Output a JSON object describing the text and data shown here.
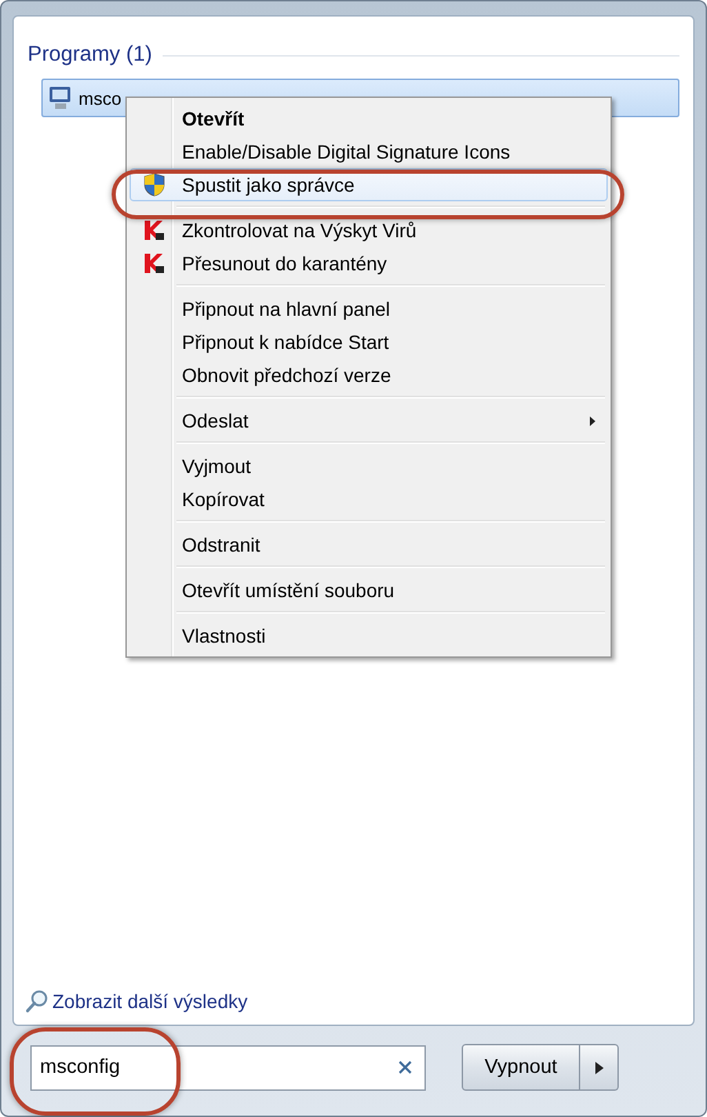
{
  "section": {
    "title": "Programy (1)"
  },
  "results": [
    {
      "label": "msco",
      "selected": true
    }
  ],
  "context_menu": {
    "items": [
      {
        "kind": "item",
        "label": "Otevřít",
        "default": true,
        "selected": false
      },
      {
        "kind": "item",
        "label": "Enable/Disable Digital Signature Icons",
        "default": false,
        "selected": false
      },
      {
        "kind": "admin",
        "label": "Spustit jako správce",
        "default": false,
        "selected": true,
        "circled": true
      },
      {
        "kind": "separator"
      },
      {
        "kind": "scan",
        "label": "Zkontrolovat na Výskyt Virů",
        "default": false,
        "selected": false
      },
      {
        "kind": "scan",
        "label": "Přesunout do karantény",
        "default": false,
        "selected": false
      },
      {
        "kind": "separator"
      },
      {
        "kind": "item",
        "label": "Připnout na hlavní panel",
        "default": false,
        "selected": false
      },
      {
        "kind": "item",
        "label": "Připnout k nabídce Start",
        "default": false,
        "selected": false
      },
      {
        "kind": "item",
        "label": "Obnovit předchozí verze",
        "default": false,
        "selected": false
      },
      {
        "kind": "separator"
      },
      {
        "kind": "item",
        "label": "Odeslat",
        "default": false,
        "selected": false,
        "submenu": true
      },
      {
        "kind": "separator"
      },
      {
        "kind": "item",
        "label": "Vyjmout",
        "default": false,
        "selected": false
      },
      {
        "kind": "item",
        "label": "Kopírovat",
        "default": false,
        "selected": false
      },
      {
        "kind": "separator"
      },
      {
        "kind": "item",
        "label": "Odstranit",
        "default": false,
        "selected": false
      },
      {
        "kind": "separator"
      },
      {
        "kind": "item",
        "label": "Otevřít umístění souboru",
        "default": false,
        "selected": false
      },
      {
        "kind": "separator"
      },
      {
        "kind": "item",
        "label": "Vlastnosti",
        "default": false,
        "selected": false
      }
    ]
  },
  "more_results": {
    "label": "Zobrazit další výsledky"
  },
  "search": {
    "value": "msconfig",
    "circled": true
  },
  "shutdown": {
    "label": "Vypnout"
  }
}
